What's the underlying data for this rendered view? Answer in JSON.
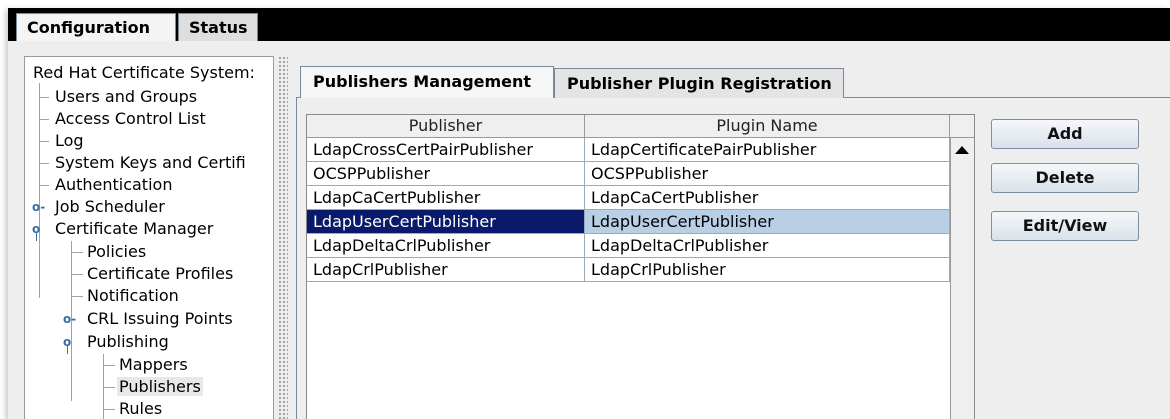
{
  "top_tabs": [
    "Configuration",
    "Status"
  ],
  "tree": {
    "root": "Red Hat Certificate System:",
    "items": [
      {
        "label": "Users and Groups"
      },
      {
        "label": "Access Control List"
      },
      {
        "label": "Log"
      },
      {
        "label": "System Keys and Certifi"
      },
      {
        "label": "Authentication"
      },
      {
        "label": "Job Scheduler"
      },
      {
        "label": "Certificate Manager"
      },
      {
        "label": "Policies"
      },
      {
        "label": "Certificate Profiles"
      },
      {
        "label": "Notification"
      },
      {
        "label": "CRL Issuing Points"
      },
      {
        "label": "Publishing"
      },
      {
        "label": "Mappers"
      },
      {
        "label": "Publishers"
      },
      {
        "label": "Rules"
      }
    ]
  },
  "sub_tabs": [
    "Publishers Management",
    "Publisher Plugin Registration"
  ],
  "table": {
    "columns": [
      "Publisher",
      "Plugin Name"
    ],
    "rows": [
      [
        "LdapCrossCertPairPublisher",
        "LdapCertificatePairPublisher"
      ],
      [
        "OCSPPublisher",
        "OCSPPublisher"
      ],
      [
        "LdapCaCertPublisher",
        "LdapCaCertPublisher"
      ],
      [
        "LdapUserCertPublisher",
        "LdapUserCertPublisher"
      ],
      [
        "LdapDeltaCrlPublisher",
        "LdapDeltaCrlPublisher"
      ],
      [
        "LdapCrlPublisher",
        "LdapCrlPublisher"
      ]
    ],
    "selected_row": 3
  },
  "buttons": {
    "add": "Add",
    "delete": "Delete",
    "edit_view": "Edit/View"
  }
}
